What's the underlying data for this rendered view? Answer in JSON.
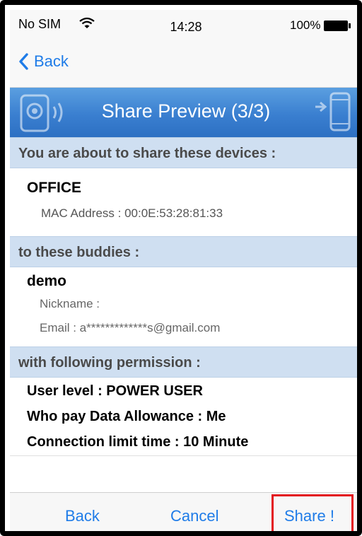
{
  "status_bar": {
    "carrier": "No SIM",
    "time": "14:28",
    "battery": "100%"
  },
  "nav": {
    "back_label": "Back"
  },
  "banner": {
    "title": "Share Preview (3/3)"
  },
  "devices_section": {
    "header": "You are about to share these devices :",
    "device_name": "OFFICE",
    "mac_address": "MAC Address : 00:0E:53:28:81:33"
  },
  "buddies_section": {
    "header": "to these buddies :",
    "buddy_name": "demo",
    "nickname": "Nickname :",
    "email": "Email : a*************s@gmail.com"
  },
  "permission_section": {
    "header": "with following permission :",
    "user_level": "User level : POWER USER",
    "data_allowance": "Who pay Data Allowance : Me",
    "connection_limit": "Connection limit time : 10 Minute"
  },
  "toolbar": {
    "back_label": "Back",
    "cancel_label": "Cancel",
    "share_label": "Share !"
  },
  "colors": {
    "accent": "#1f7ce8",
    "banner": "#3a7fd0",
    "section_bg": "#cfdff1",
    "highlight": "#e3121b"
  }
}
